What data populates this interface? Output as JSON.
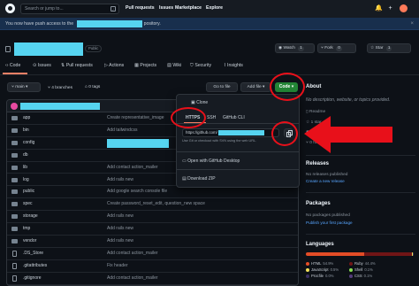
{
  "header": {
    "search_placeholder": "Search or jump to...",
    "slash_key": "/",
    "nav": [
      "Pull requests",
      "Issues",
      "Marketplace",
      "Explore"
    ],
    "bell": "🔔",
    "plus": "+"
  },
  "notice": {
    "text_before": "You now have push access to the",
    "text_after": "pository.",
    "close": "×"
  },
  "repo": {
    "visibility": "Public",
    "watch": "Watch",
    "watch_count": "1",
    "fork": "Fork",
    "fork_count": "0",
    "star": "Star",
    "star_count": "1"
  },
  "tabs": [
    "Code",
    "Issues",
    "Pull requests",
    "Actions",
    "Projects",
    "Wiki",
    "Security",
    "Insights"
  ],
  "branch_bar": {
    "branch": "main",
    "branches": "4 branches",
    "tags": "0 tags",
    "go_to_file": "Go to file",
    "add_file": "Add file",
    "code": "Code"
  },
  "files": [
    {
      "name": "app",
      "msg": "Create representative_image",
      "type": "dir"
    },
    {
      "name": "bin",
      "msg": "Add tailwindcss",
      "type": "dir"
    },
    {
      "name": "config",
      "msg": "",
      "type": "dir"
    },
    {
      "name": "db",
      "msg": "",
      "type": "dir"
    },
    {
      "name": "lib",
      "msg": "Add contact action_mailer",
      "type": "dir"
    },
    {
      "name": "log",
      "msg": "Add rails new",
      "type": "dir"
    },
    {
      "name": "public",
      "msg": "Add google search console file",
      "type": "dir"
    },
    {
      "name": "spec",
      "msg": "Create password_reset_edit, question_new space",
      "type": "dir"
    },
    {
      "name": "storage",
      "msg": "Add rails new",
      "type": "dir"
    },
    {
      "name": "tmp",
      "msg": "Add rails new",
      "type": "dir"
    },
    {
      "name": "vendor",
      "msg": "Add rails new",
      "type": "dir"
    },
    {
      "name": ".DS_Store",
      "msg": "Add contact action_mailer",
      "type": "file"
    },
    {
      "name": ".gitattributes",
      "msg": "Fix header",
      "type": "file"
    },
    {
      "name": ".gitignore",
      "msg": "Add contact action_mailer",
      "type": "file"
    }
  ],
  "dropdown": {
    "clone": "Clone",
    "tabs": [
      "HTTPS",
      "SSH",
      "GitHub CLI"
    ],
    "url": "https://github.com/",
    "hint": "Use Git or checkout with SVN using the web URL.",
    "open_desktop": "Open with GitHub Desktop",
    "download_zip": "Download ZIP"
  },
  "sidebar": {
    "about": "About",
    "description": "No description, website, or topics provided.",
    "readme": "Readme",
    "star": "1 star",
    "watching": "1 watching",
    "forks": "0 forks",
    "releases": "Releases",
    "no_releases": "No releases published",
    "create_release": "Create a new release",
    "packages": "Packages",
    "no_packages": "No packages published",
    "publish_package": "Publish your first package",
    "languages": "Languages",
    "langs": [
      {
        "name": "HTML",
        "pct": "54.9%",
        "color": "#e34c26"
      },
      {
        "name": "Ruby",
        "pct": "44.4%",
        "color": "#701516"
      },
      {
        "name": "JavaScript",
        "pct": "0.5%",
        "color": "#f1e05a"
      },
      {
        "name": "Shell",
        "pct": "0.1%",
        "color": "#89e051"
      },
      {
        "name": "Procfile",
        "pct": "0.0%",
        "color": "#3b2f63"
      },
      {
        "name": "CSS",
        "pct": "0.1%",
        "color": "#563d7c"
      }
    ]
  },
  "annotation": {
    "color": "#e8101a"
  }
}
